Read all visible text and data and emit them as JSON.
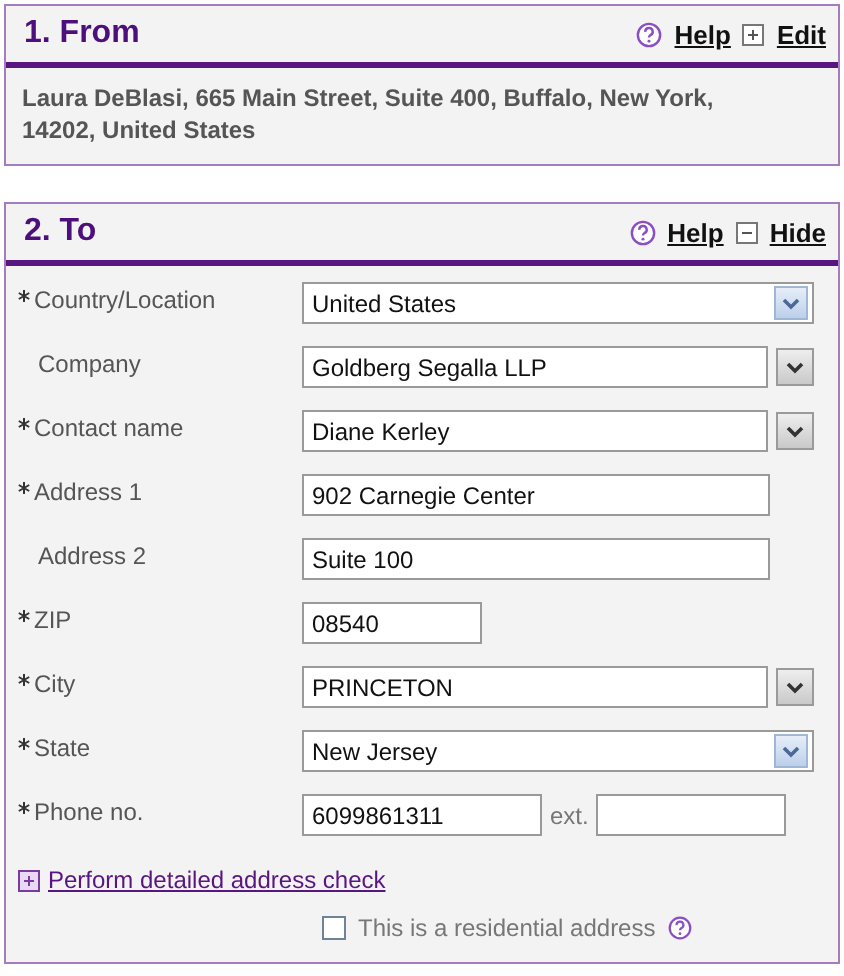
{
  "from": {
    "title": "1. From",
    "help": "Help",
    "toggle": {
      "label": "Edit",
      "expanded": false
    },
    "address": "Laura DeBlasi, 665 Main Street, Suite 400, Buffalo, New York, 14202, United States"
  },
  "to": {
    "title": "2. To",
    "help": "Help",
    "toggle": {
      "label": "Hide",
      "expanded": true
    },
    "fields": [
      {
        "label": "Country/Location",
        "required": true,
        "kind": "select",
        "value": "United States"
      },
      {
        "label": "Company",
        "required": false,
        "kind": "combo",
        "value": "Goldberg Segalla LLP"
      },
      {
        "label": "Contact name",
        "required": true,
        "kind": "combo",
        "value": "Diane Kerley"
      },
      {
        "label": "Address 1",
        "required": true,
        "kind": "text",
        "value": "902 Carnegie Center"
      },
      {
        "label": "Address 2",
        "required": false,
        "kind": "text",
        "value": "Suite 100"
      },
      {
        "label": "ZIP",
        "required": true,
        "kind": "short",
        "value": "08540"
      },
      {
        "label": "City",
        "required": true,
        "kind": "combo",
        "value": "PRINCETON"
      },
      {
        "label": "State",
        "required": true,
        "kind": "select",
        "value": "New Jersey"
      },
      {
        "label": "Phone no.",
        "required": true,
        "kind": "phone",
        "value": "6099861311",
        "ext_label": "ext."
      }
    ],
    "address_check": {
      "label": "Perform detailed address check",
      "expanded": false
    },
    "residential": {
      "label": "This is a residential address",
      "checked": false
    }
  }
}
